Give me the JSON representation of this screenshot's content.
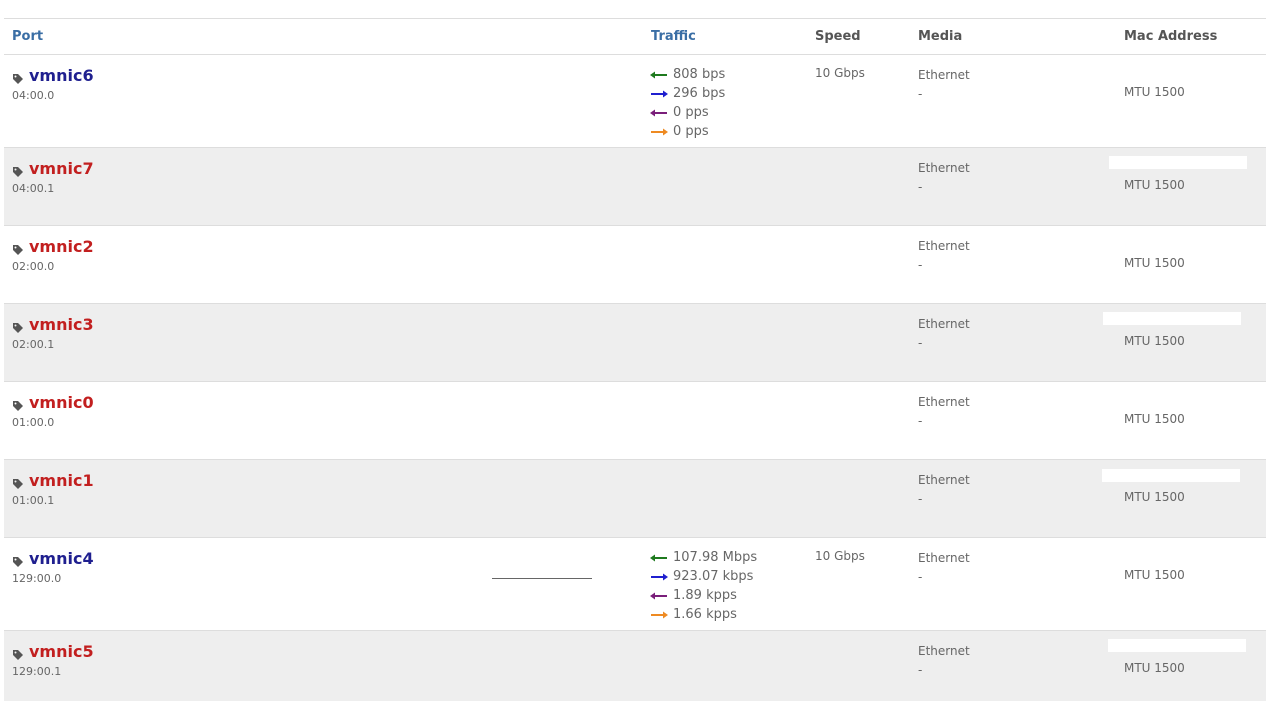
{
  "headers": {
    "port": "Port",
    "traffic": "Traffic",
    "speed": "Speed",
    "media": "Media",
    "mac": "Mac Address"
  },
  "colors": {
    "link_up": "#1f1f8f",
    "link_down": "#c21f1f",
    "rx_arrow": "#1e7a1e",
    "tx_arrow": "#1f1fcf",
    "rx_pps_arrow": "#7a1e7a",
    "tx_pps_arrow": "#ee8a22"
  },
  "ports": [
    {
      "name": "vmnic6",
      "pci": "04:00.0",
      "status": "up",
      "traffic": [
        "808 bps",
        "296 bps",
        "0 pps",
        "0 pps"
      ],
      "speed": "10 Gbps",
      "media": "Ethernet",
      "media_detail": "-",
      "mtu": "MTU 1500"
    },
    {
      "name": "vmnic7",
      "pci": "04:00.1",
      "status": "down",
      "traffic": [],
      "speed": "",
      "media": "Ethernet",
      "media_detail": "-",
      "mtu": "MTU 1500"
    },
    {
      "name": "vmnic2",
      "pci": "02:00.0",
      "status": "down",
      "traffic": [],
      "speed": "",
      "media": "Ethernet",
      "media_detail": "-",
      "mtu": "MTU 1500"
    },
    {
      "name": "vmnic3",
      "pci": "02:00.1",
      "status": "down",
      "traffic": [],
      "speed": "",
      "media": "Ethernet",
      "media_detail": "-",
      "mtu": "MTU 1500"
    },
    {
      "name": "vmnic0",
      "pci": "01:00.0",
      "status": "down",
      "traffic": [],
      "speed": "",
      "media": "Ethernet",
      "media_detail": "-",
      "mtu": "MTU 1500"
    },
    {
      "name": "vmnic1",
      "pci": "01:00.1",
      "status": "down",
      "traffic": [],
      "speed": "",
      "media": "Ethernet",
      "media_detail": "-",
      "mtu": "MTU 1500"
    },
    {
      "name": "vmnic4",
      "pci": "129:00.0",
      "status": "up",
      "traffic": [
        "107.98 Mbps",
        "923.07 kbps",
        "1.89 kpps",
        "1.66 kpps"
      ],
      "speed": "10 Gbps",
      "media": "Ethernet",
      "media_detail": "-",
      "mtu": "MTU 1500"
    },
    {
      "name": "vmnic5",
      "pci": "129:00.1",
      "status": "down",
      "traffic": [],
      "speed": "",
      "media": "Ethernet",
      "media_detail": "-",
      "mtu": "MTU 1500"
    }
  ]
}
